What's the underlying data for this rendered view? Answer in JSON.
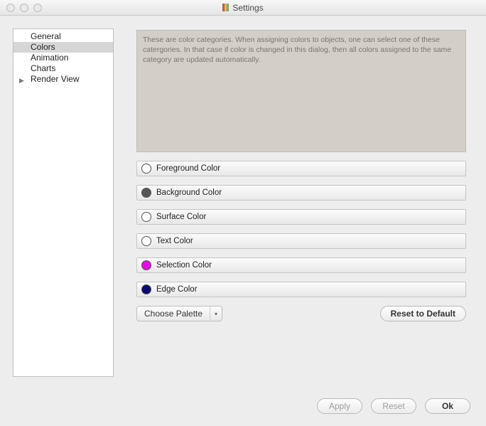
{
  "window": {
    "title": "Settings"
  },
  "sidebar": {
    "items": [
      {
        "label": "General",
        "selected": false,
        "expandable": false
      },
      {
        "label": "Colors",
        "selected": true,
        "expandable": false
      },
      {
        "label": "Animation",
        "selected": false,
        "expandable": false
      },
      {
        "label": "Charts",
        "selected": false,
        "expandable": false
      },
      {
        "label": "Render View",
        "selected": false,
        "expandable": true
      }
    ]
  },
  "panel": {
    "description": "These are color categories. When assigning colors to objects, one can select one of these catergories. In that case if color is changed in this dialog, then all colors assigned to the same category are updated automatically.",
    "colors": [
      {
        "label": "Foreground Color",
        "value": "#ffffff"
      },
      {
        "label": "Background Color",
        "value": "#565656"
      },
      {
        "label": "Surface Color",
        "value": "#ffffff"
      },
      {
        "label": "Text Color",
        "value": "#ffffff"
      },
      {
        "label": "Selection Color",
        "value": "#e80be3"
      },
      {
        "label": "Edge Color",
        "value": "#0a0a70"
      }
    ],
    "choose_palette_label": "Choose Palette",
    "reset_to_default_label": "Reset to Default"
  },
  "footer": {
    "apply_label": "Apply",
    "reset_label": "Reset",
    "ok_label": "Ok"
  }
}
